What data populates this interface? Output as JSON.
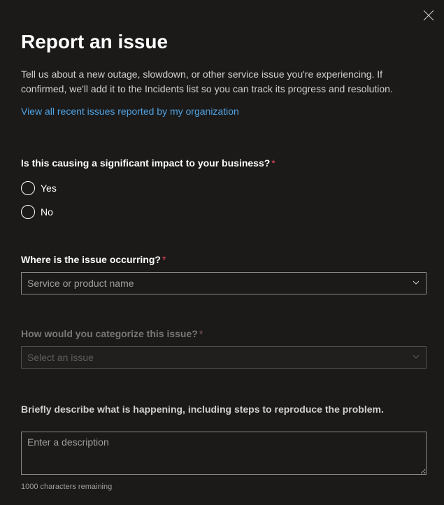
{
  "title": "Report an issue",
  "description": "Tell us about a new outage, slowdown, or other service issue you're experiencing. If confirmed, we'll add it to the Incidents list so you can track its progress and resolution.",
  "link": "View all recent issues reported by my organization",
  "impact": {
    "label": "Is this causing a significant impact to your business?",
    "options": {
      "yes": "Yes",
      "no": "No"
    }
  },
  "location": {
    "label": "Where is the issue occurring?",
    "placeholder": "Service or product name"
  },
  "category": {
    "label": "How would you categorize this issue?",
    "placeholder": "Select an issue"
  },
  "desc": {
    "label": "Briefly describe what is happening, including steps to reproduce the problem.",
    "placeholder": "Enter a description"
  },
  "counter": "1000 characters remaining",
  "required_marker": "*"
}
